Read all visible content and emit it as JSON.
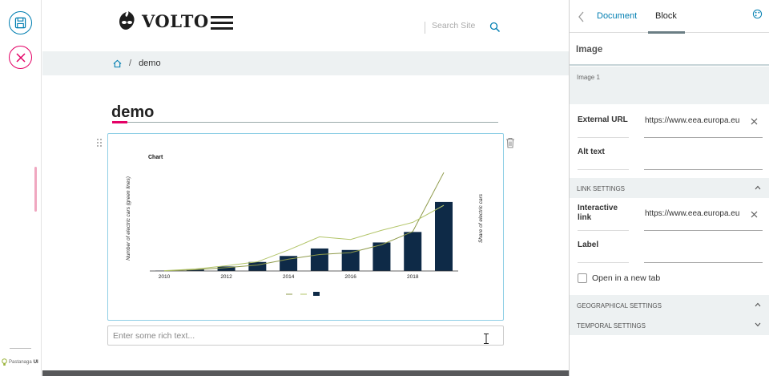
{
  "toolbar": {
    "brand_prefix": "Pastanaga",
    "brand_suffix": "UI"
  },
  "header": {
    "logo_text": "VOLTO",
    "search_placeholder": "Search Site"
  },
  "breadcrumbs": {
    "current": "demo"
  },
  "document": {
    "title": "demo",
    "rich_text_placeholder": "Enter some rich text..."
  },
  "chart_data": {
    "type": "line",
    "title": "Chart",
    "xlabel": "",
    "ylabel": "Number of electric cars (green lines)",
    "y2label": "Share of electric cars",
    "x_ticks": [
      "2010",
      "2012",
      "2014",
      "2016",
      "2018"
    ],
    "x": [
      2010,
      2011,
      2012,
      2013,
      2014,
      2015,
      2016,
      2017,
      2018,
      2019
    ],
    "bars": [
      0.1,
      0.6,
      1.5,
      3.0,
      5.0,
      7.5,
      7.0,
      9.5,
      13.0,
      23.0
    ],
    "series": [
      {
        "color": "#8e9a4a",
        "values": [
          0.1,
          1.0,
          2.5,
          4.5,
          9.0,
          12.5,
          14.0,
          20.0,
          30.0,
          75.0
        ]
      },
      {
        "color": "#b3c56a",
        "values": [
          0.2,
          1.5,
          4.0,
          7.0,
          16.0,
          26.0,
          24.0,
          31.0,
          37.0,
          50.0
        ]
      }
    ],
    "ylim": [
      0,
      80
    ],
    "bar_lim": [
      0,
      35
    ],
    "bar_color": "#0e2a47",
    "legend": "bottom"
  },
  "sidebar": {
    "tabs": [
      "Document",
      "Block"
    ],
    "section_title": "Image",
    "image_label": "Image 1",
    "fields": {
      "external_url_label": "External URL",
      "external_url_value": "https://www.eea.europa.eu",
      "alt_text_label": "Alt text",
      "interactive_link_label": "Interactive link",
      "interactive_link_value": "https://www.eea.europa.eu",
      "label_label": "Label"
    },
    "link_settings": "LINK SETTINGS",
    "open_new_tab": "Open in a new tab",
    "geo_settings": "GEOGRAPHICAL SETTINGS",
    "temporal_settings": "TEMPORAL SETTINGS"
  }
}
